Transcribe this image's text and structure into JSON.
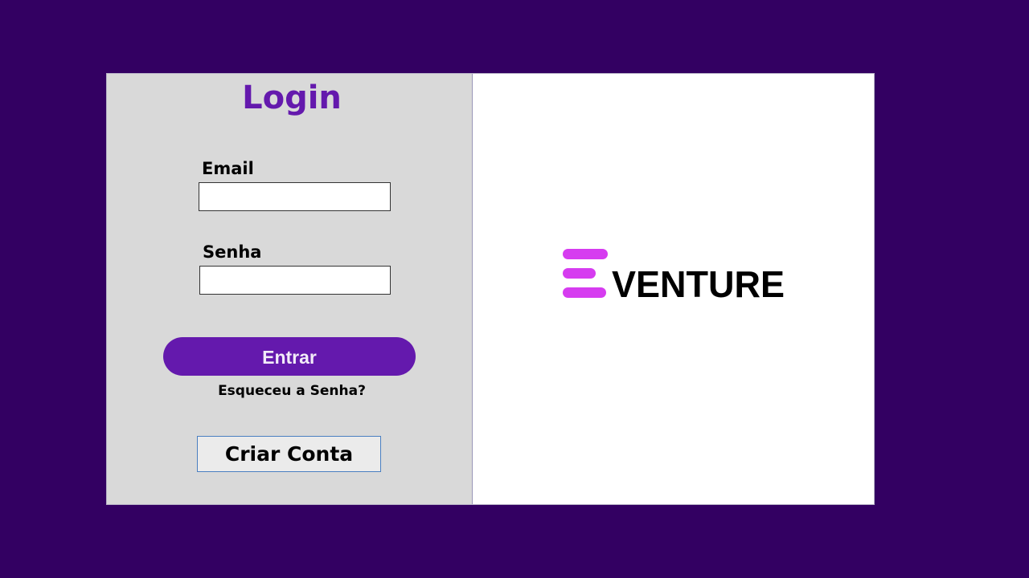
{
  "login": {
    "title": "Login",
    "email_label": "Email",
    "email_value": "",
    "password_label": "Senha",
    "password_value": "",
    "submit_label": "Entrar",
    "forgot_label": "Esqueceu a Senha?",
    "create_account_label": "Criar Conta"
  },
  "brand": {
    "logo_text": "VENTURE",
    "logo_mark_letter": "E",
    "logo_mark_color": "#d63cf0",
    "logo_text_color": "#000000"
  },
  "colors": {
    "background": "#330062",
    "accent": "#6419ad",
    "panel": "#d9d9d9"
  }
}
